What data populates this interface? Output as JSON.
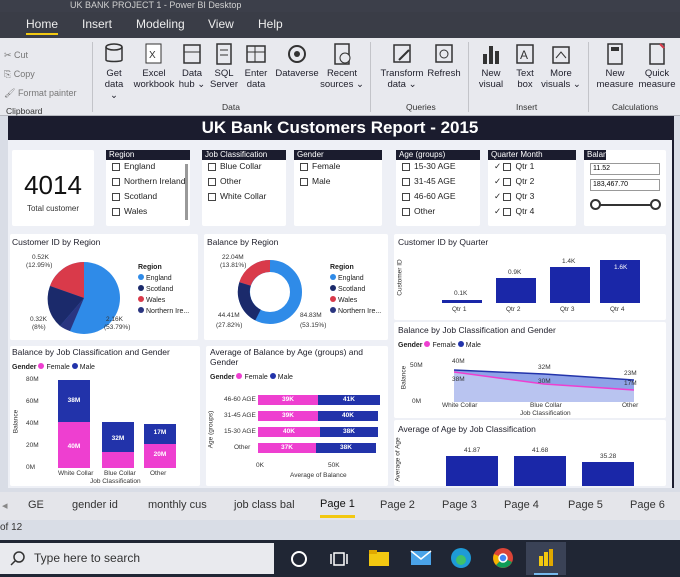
{
  "window": {
    "title": "UK BANK PROJECT 1 - Power BI Desktop"
  },
  "menu": {
    "tabs": [
      "Home",
      "Insert",
      "Modeling",
      "View",
      "Help"
    ],
    "active": "Home"
  },
  "ribbon": {
    "clipboard": {
      "cut": "Cut",
      "copy": "Copy",
      "format_painter": "Format painter",
      "label": "Clipboard"
    },
    "data": [
      {
        "l1": "Get",
        "l2": "data ⌄",
        "icon": "database-icon"
      },
      {
        "l1": "Excel",
        "l2": "workbook",
        "icon": "excel-icon"
      },
      {
        "l1": "Data",
        "l2": "hub ⌄",
        "icon": "data-hub-icon"
      },
      {
        "l1": "SQL",
        "l2": "Server",
        "icon": "sql-server-icon"
      },
      {
        "l1": "Enter",
        "l2": "data",
        "icon": "table-icon"
      },
      {
        "l1": "Dataverse",
        "l2": "",
        "icon": "dataverse-icon"
      },
      {
        "l1": "Recent",
        "l2": "sources ⌄",
        "icon": "recent-icon"
      }
    ],
    "data_label": "Data",
    "queries": [
      {
        "l1": "Transform",
        "l2": "data ⌄",
        "icon": "transform-icon"
      },
      {
        "l1": "Refresh",
        "l2": "",
        "icon": "refresh-icon"
      }
    ],
    "queries_label": "Queries",
    "insert": [
      {
        "l1": "New",
        "l2": "visual",
        "icon": "chart-icon"
      },
      {
        "l1": "Text",
        "l2": "box",
        "icon": "textbox-icon"
      },
      {
        "l1": "More",
        "l2": "visuals ⌄",
        "icon": "more-visuals-icon"
      }
    ],
    "insert_label": "Insert",
    "calculations": [
      {
        "l1": "New",
        "l2": "measure",
        "icon": "calculator-icon"
      },
      {
        "l1": "Quick",
        "l2": "measure",
        "icon": "quick-measure-icon"
      }
    ],
    "calculations_label": "Calculations"
  },
  "report": {
    "title": "UK Bank Customers Report - 2015",
    "kpi": {
      "value": "4014",
      "label": "Total customer"
    },
    "slicers": {
      "region": {
        "header": "Region",
        "items": [
          "England",
          "Northern Ireland",
          "Scotland",
          "Wales"
        ]
      },
      "job": {
        "header": "Job Classification",
        "items": [
          "Blue Collar",
          "Other",
          "White Collar"
        ]
      },
      "gender": {
        "header": "Gender",
        "items": [
          "Female",
          "Male"
        ]
      },
      "age": {
        "header": "Age (groups)",
        "items": [
          "15-30 AGE",
          "31-45 AGE",
          "46-60 AGE",
          "Other"
        ]
      },
      "quarter": {
        "header": "Quarter Month",
        "items": [
          "Qtr 1",
          "Qtr 2",
          "Qtr 3",
          "Qtr 4"
        ]
      },
      "balance": {
        "header": "Balance",
        "min": "11.52",
        "max": "183,467.70"
      }
    },
    "pie_region": {
      "title": "Customer ID by Region",
      "legend_title": "Region",
      "legend": [
        "England",
        "Scotland",
        "Wales",
        "Northern Ire..."
      ],
      "labels": {
        "top": "0.52K",
        "top_pct": "(12.95%)",
        "left": "0.32K",
        "left_pct": "(8%)",
        "right": "2.16K",
        "right_pct": "(53.79%)"
      },
      "colors": [
        "#2f8be8",
        "#1b2a6b",
        "#d93a4a",
        "#2a3580"
      ]
    },
    "donut_balance": {
      "title": "Balance by Region",
      "legend_title": "Region",
      "legend": [
        "England",
        "Scotland",
        "Wales",
        "Northern Ire..."
      ],
      "labels": {
        "top": "22.04M",
        "top_pct": "(13.81%)",
        "left": "44.41M",
        "left_pct": "(27.82%)",
        "right": "84.83M",
        "right_pct": "(53.15%)"
      }
    },
    "quarter_chart": {
      "title": "Customer ID by Quarter",
      "ylabel": "Customer ID",
      "xlabel": "Quarter",
      "categories": [
        "Qtr 1",
        "Qtr 2",
        "Qtr 3",
        "Qtr 4"
      ],
      "labels": [
        "0.1K",
        "0.9K",
        "1.4K",
        "1.6K"
      ]
    },
    "stacked_job": {
      "title": "Balance by Job Classification and Gender",
      "legend_title": "Gender",
      "legend": [
        "Female",
        "Male"
      ],
      "yticks": [
        "80M",
        "60M",
        "40M",
        "20M",
        "0M"
      ],
      "ylabel": "Balance",
      "xlabel": "Job Classification",
      "categories": [
        "White Collar",
        "Blue Collar",
        "Other"
      ],
      "male_labels": [
        "38M",
        "32M",
        "17M"
      ],
      "female_labels": [
        "40M",
        "",
        "20M"
      ]
    },
    "age_bars": {
      "title": "Average of Balance by Age (groups) and Gender",
      "legend_title": "Gender",
      "legend": [
        "Female",
        "Male"
      ],
      "ylabel": "Age (groups)",
      "xlabel": "Average of Balance",
      "rows": [
        "46-60 AGE",
        "31-45 AGE",
        "15-30 AGE",
        "Other"
      ],
      "female": [
        "39K",
        "39K",
        "40K",
        "37K"
      ],
      "male": [
        "41K",
        "40K",
        "38K",
        "38K"
      ],
      "xticks": [
        "0K",
        "50K"
      ]
    },
    "area_job": {
      "title": "Balance by Job Classification and Gender",
      "legend_title": "Gender",
      "legend": [
        "Female",
        "Male"
      ],
      "yticks": [
        "50M",
        "0M"
      ],
      "ylabel": "Balance",
      "xlabel": "Job Classification",
      "categories": [
        "White Collar",
        "Blue Collar",
        "Other"
      ],
      "labels": [
        "40M",
        "38M",
        "32M",
        "30M",
        "23M",
        "17M"
      ]
    },
    "avg_age": {
      "title": "Average of Age by Job Classification",
      "ylabel": "Average of Age",
      "labels": [
        "41.87",
        "41.68",
        "35.28"
      ]
    }
  },
  "pages": {
    "tabs": [
      "GE",
      "gender id",
      "monthly cus",
      "job class bal",
      "Page 1",
      "Page 2",
      "Page 3",
      "Page 4",
      "Page 5",
      "Page 6"
    ],
    "active": "Page 1",
    "count": "of 12"
  },
  "taskbar": {
    "search_placeholder": "Type here to search"
  },
  "colors": {
    "accent": "#f2c811",
    "navy": "#1b1c2e",
    "male": "#2233aa",
    "female": "#ee3fd0",
    "blue": "#2f8be8"
  }
}
